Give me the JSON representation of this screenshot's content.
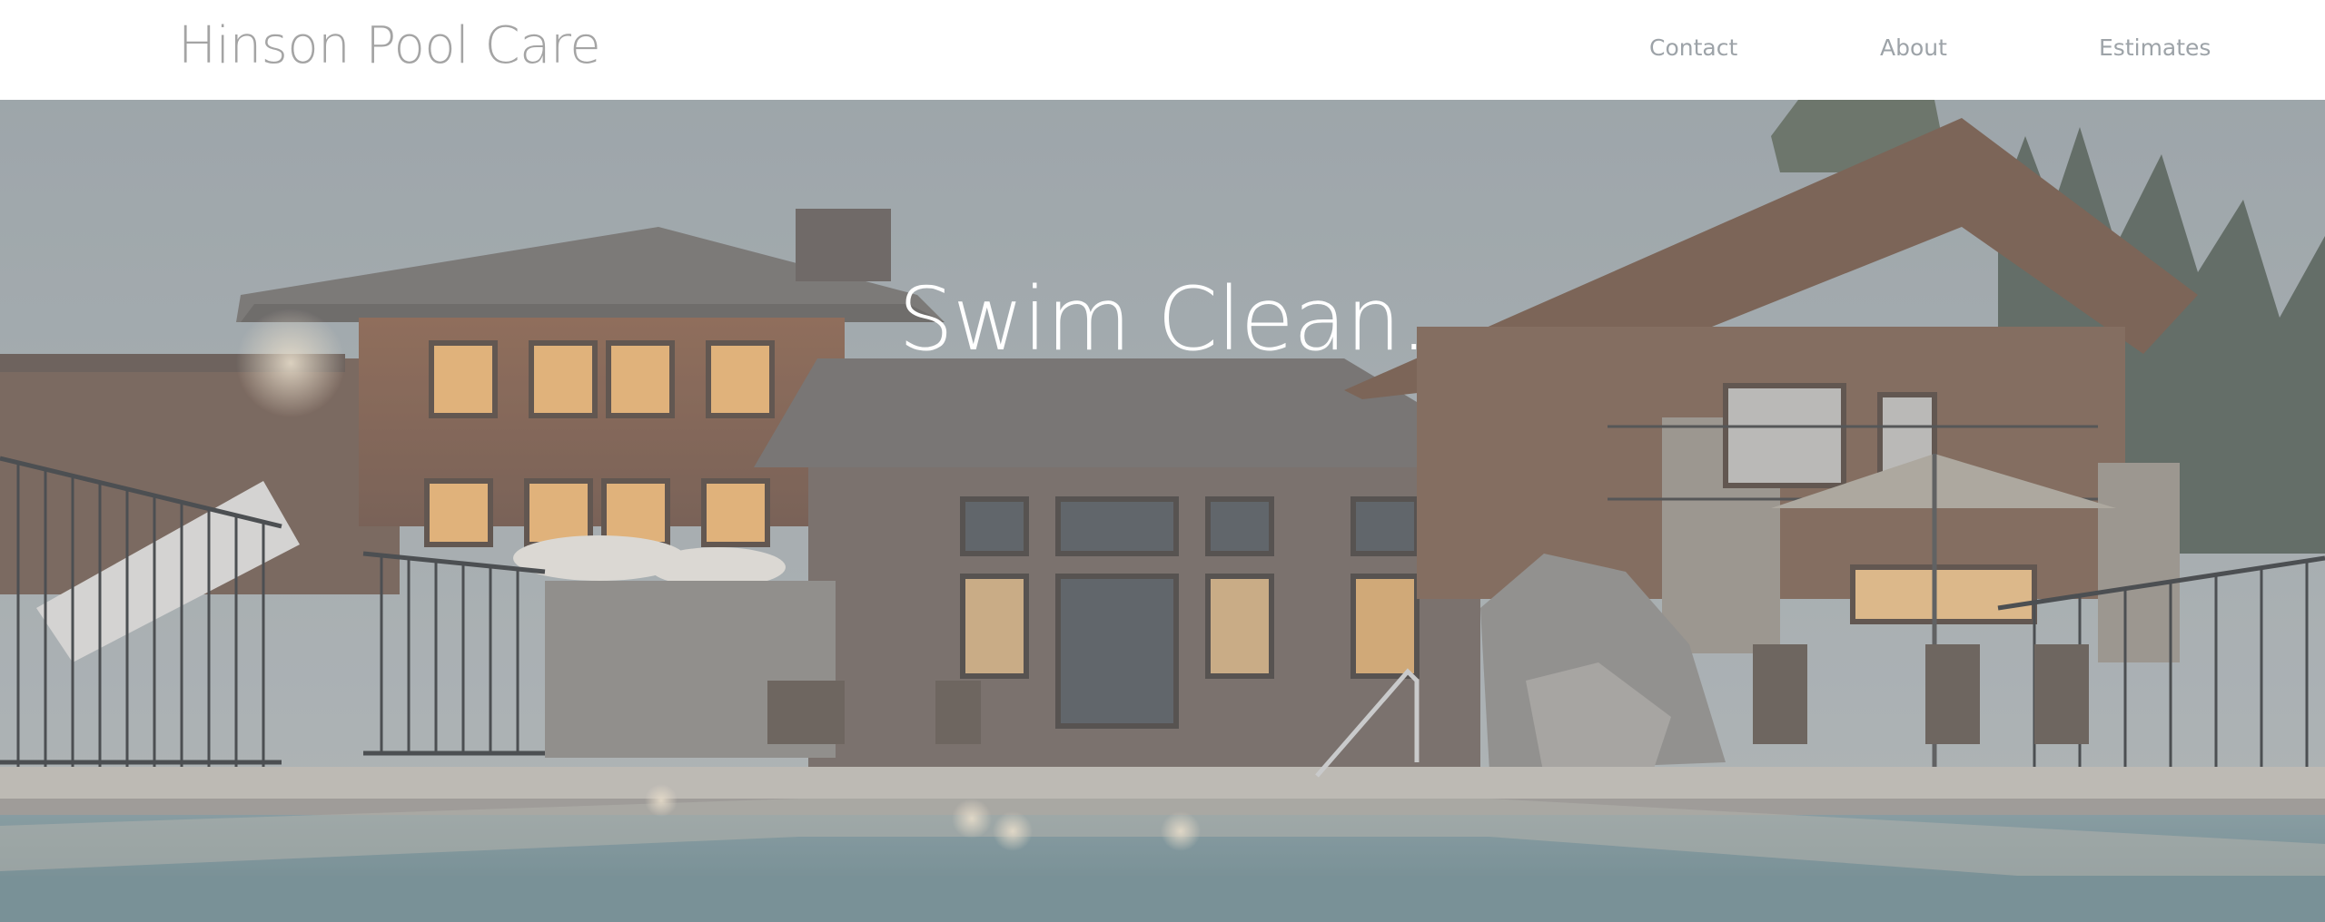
{
  "header": {
    "logo_text": "Hinson Pool Care",
    "nav": [
      {
        "label": "Contact"
      },
      {
        "label": "About"
      },
      {
        "label": "Estimates"
      }
    ]
  },
  "hero": {
    "title": "Swim Clean.",
    "image_description_icon": "house-with-pool-photo"
  },
  "colors": {
    "logo": "#a4a4a4",
    "nav": "#9da3a8",
    "hero_title": "#ffffff",
    "header_bg": "#ffffff"
  }
}
